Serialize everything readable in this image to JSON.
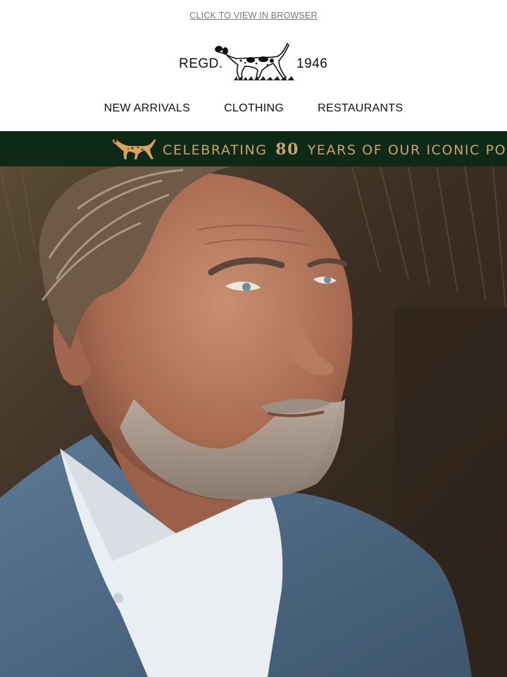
{
  "header": {
    "view_link": "CLICK TO VIEW IN BROWSER",
    "logo_left": "REGD.",
    "logo_right": "1946",
    "logo_icon": "pointer-dog-logo"
  },
  "nav": {
    "items": [
      {
        "label": "NEW ARRIVALS"
      },
      {
        "label": "CLOTHING"
      },
      {
        "label": "RESTAURANTS"
      }
    ]
  },
  "banner": {
    "text_before": "CELEBRATING",
    "number": "80",
    "text_after": "YEARS OF OUR ICONIC PO",
    "icon": "dog-icon",
    "background": "#0e2a17",
    "accent": "#c9a46a"
  },
  "hero": {
    "icon": "hero-portrait-photo"
  }
}
